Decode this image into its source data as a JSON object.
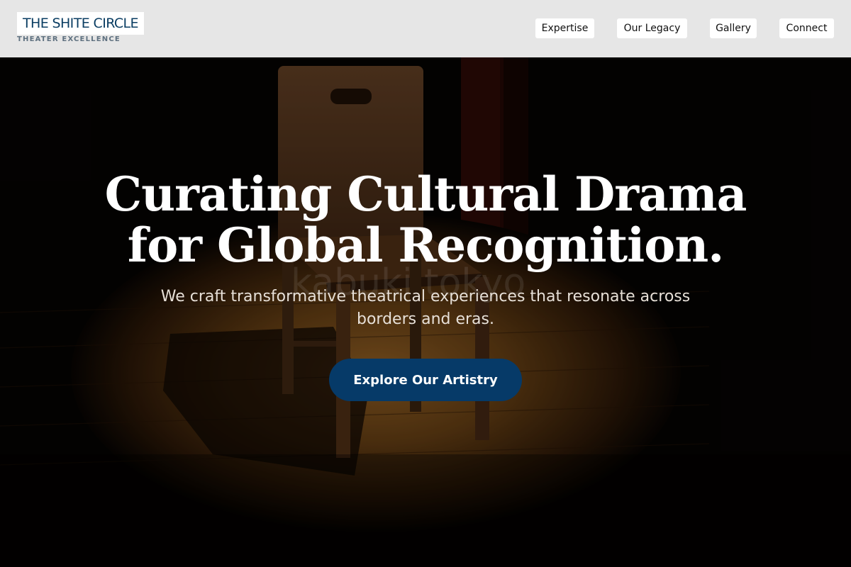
{
  "brand": {
    "title": "THE SHITE CIRCLE",
    "subtitle": "THEATER EXCELLENCE"
  },
  "nav": {
    "items": [
      {
        "label": "Expertise"
      },
      {
        "label": "Our Legacy"
      },
      {
        "label": "Gallery"
      },
      {
        "label": "Connect"
      }
    ]
  },
  "hero": {
    "headline": "Curating Cultural Drama for Global Recognition.",
    "subtext": "We craft transformative theatrical experiences that resonate across borders and eras.",
    "cta_label": "Explore Our Artistry",
    "background_image": "wooden-chair-on-spotlit-stage"
  },
  "colors": {
    "header_bg": "#e6e6e6",
    "brand": "#0b3e63",
    "cta_bg": "#063a68"
  }
}
